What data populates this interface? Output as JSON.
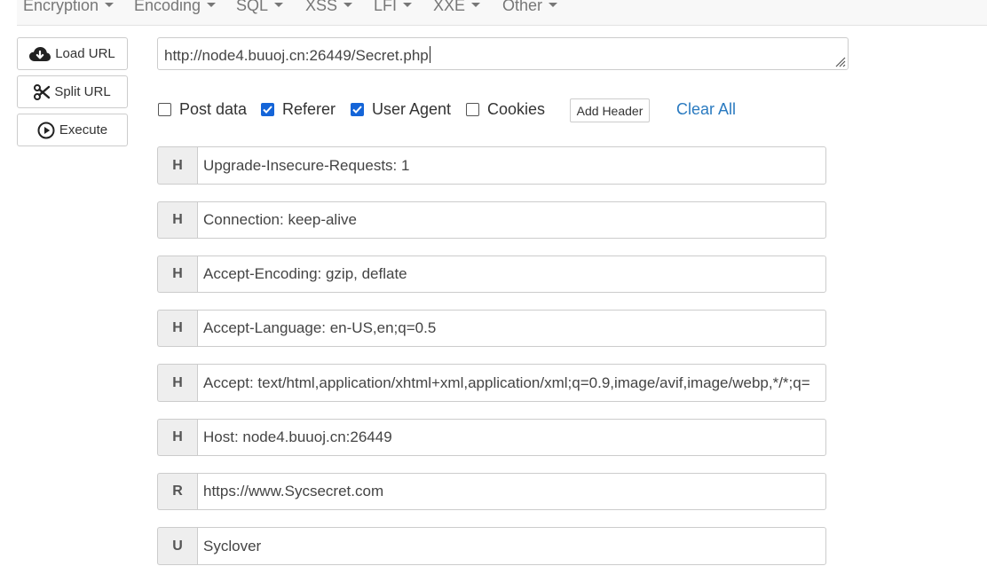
{
  "menu": [
    {
      "label": "Encryption"
    },
    {
      "label": "Encoding"
    },
    {
      "label": "SQL"
    },
    {
      "label": "XSS"
    },
    {
      "label": "LFI"
    },
    {
      "label": "XXE"
    },
    {
      "label": "Other"
    }
  ],
  "buttons": {
    "load_url": "Load URL",
    "split_url": "Split URL",
    "execute": "Execute"
  },
  "url": {
    "value": "http://node4.buuoj.cn:26449/Secret.php"
  },
  "options": {
    "post_data": {
      "label": "Post data",
      "checked": false
    },
    "referer": {
      "label": "Referer",
      "checked": true
    },
    "user_agent": {
      "label": "User Agent",
      "checked": true
    },
    "cookies": {
      "label": "Cookies",
      "checked": false
    },
    "add_header": "Add Header",
    "clear_all": "Clear All"
  },
  "headers": [
    {
      "type": "H",
      "value": "Upgrade-Insecure-Requests: 1"
    },
    {
      "type": "H",
      "value": "Connection: keep-alive"
    },
    {
      "type": "H",
      "value": "Accept-Encoding: gzip, deflate"
    },
    {
      "type": "H",
      "value": "Accept-Language: en-US,en;q=0.5"
    },
    {
      "type": "H",
      "value": "Accept: text/html,application/xhtml+xml,application/xml;q=0.9,image/avif,image/webp,*/*;q="
    },
    {
      "type": "H",
      "value": "Host: node4.buuoj.cn:26449"
    },
    {
      "type": "R",
      "value": "https://www.Sycsecret.com"
    },
    {
      "type": "U",
      "value": "Syclover"
    }
  ],
  "colors": {
    "checkbox_checked": "#1565d8",
    "link": "#2a7ac0",
    "menu_text": "#777777"
  }
}
